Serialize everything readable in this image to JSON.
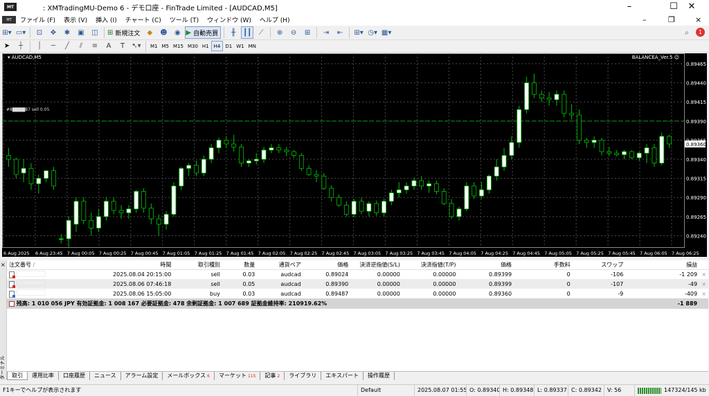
{
  "window": {
    "title": ": XMTradingMU-Demo 6 - デモ口座 - FinTrade Limited - [AUDCAD,M5]",
    "app_icon": "mt4-icon",
    "buttons": [
      "minimize-icon",
      "maximize-icon",
      "close-icon"
    ]
  },
  "menu": {
    "items": [
      "ファイル (F)",
      "表示 (V)",
      "挿入 (I)",
      "チャート (C)",
      "ツール (T)",
      "ウィンドウ (W)",
      "ヘルプ (H)"
    ],
    "search_icon": "search-icon",
    "alert_count": "1"
  },
  "toolbar": {
    "new_order": "新規注文",
    "auto_trade": "自動売買"
  },
  "timeframes": [
    "M1",
    "M5",
    "M15",
    "M30",
    "H1",
    "H4",
    "D1",
    "W1",
    "MN"
  ],
  "timeframe_active": "H4",
  "drawing_tools": {
    "text_tool": "A",
    "label_tool": "T"
  },
  "chart": {
    "symbol_label": "AUDCAD,M5",
    "ea_label": "BALANCEA_Ver.5 ☺",
    "order_line_label": "#8▇▇▇▇87 sell 0.05",
    "current_price": "0.89360",
    "colors": {
      "background": "#000000",
      "bull": "#ffffff",
      "bear": "#000000",
      "wick": "#00c000",
      "grid": "#4a4a4a",
      "order_line": "#00a000"
    }
  },
  "chart_data": {
    "type": "candlestick",
    "price_axis_ticks": [
      "0.89465",
      "0.89440",
      "0.89415",
      "0.89390",
      "0.89365",
      "0.89340",
      "0.89315",
      "0.89290",
      "0.89265",
      "0.89240"
    ],
    "time_axis_ticks": [
      "6 Aug 2025",
      "6 Aug 23:45",
      "7 Aug 00:05",
      "7 Aug 00:25",
      "7 Aug 00:45",
      "7 Aug 01:05",
      "7 Aug 01:25",
      "7 Aug 01:45",
      "7 Aug 02:05",
      "7 Aug 02:25",
      "7 Aug 02:45",
      "7 Aug 03:05",
      "7 Aug 03:25",
      "7 Aug 03:45",
      "7 Aug 04:05",
      "7 Aug 04:25",
      "7 Aug 04:45",
      "7 Aug 05:05",
      "7 Aug 05:25",
      "7 Aug 05:45",
      "7 Aug 06:05",
      "7 Aug 06:25"
    ],
    "order_line_price": 0.8939,
    "current_price": 0.8936,
    "ylim": [
      0.89225,
      0.89475
    ],
    "candles": [
      {
        "o": 0.89345,
        "h": 0.89355,
        "l": 0.8933,
        "c": 0.8934
      },
      {
        "o": 0.8934,
        "h": 0.89342,
        "l": 0.89315,
        "c": 0.8932
      },
      {
        "o": 0.89322,
        "h": 0.8934,
        "l": 0.8931,
        "c": 0.89328
      },
      {
        "o": 0.89328,
        "h": 0.89335,
        "l": 0.893,
        "c": 0.89308
      },
      {
        "o": 0.89308,
        "h": 0.8932,
        "l": 0.89295,
        "c": 0.89315
      },
      {
        "o": 0.89315,
        "h": 0.89326,
        "l": 0.8931,
        "c": 0.89325
      },
      {
        "o": 0.89325,
        "h": 0.8933,
        "l": 0.893,
        "c": 0.89305
      },
      {
        "o": 0.89236,
        "h": 0.89242,
        "l": 0.8923,
        "c": 0.89236
      },
      {
        "o": 0.89236,
        "h": 0.89265,
        "l": 0.89225,
        "c": 0.8926
      },
      {
        "o": 0.89255,
        "h": 0.8929,
        "l": 0.89245,
        "c": 0.89285
      },
      {
        "o": 0.89285,
        "h": 0.8929,
        "l": 0.89255,
        "c": 0.8926
      },
      {
        "o": 0.8926,
        "h": 0.8927,
        "l": 0.8924,
        "c": 0.8925
      },
      {
        "o": 0.8925,
        "h": 0.89275,
        "l": 0.89245,
        "c": 0.89265
      },
      {
        "o": 0.89265,
        "h": 0.8929,
        "l": 0.8926,
        "c": 0.89285
      },
      {
        "o": 0.89285,
        "h": 0.8929,
        "l": 0.89268,
        "c": 0.89273
      },
      {
        "o": 0.89273,
        "h": 0.8928,
        "l": 0.89262,
        "c": 0.8927
      },
      {
        "o": 0.8927,
        "h": 0.8928,
        "l": 0.89262,
        "c": 0.89275
      },
      {
        "o": 0.89275,
        "h": 0.893,
        "l": 0.8927,
        "c": 0.89298
      },
      {
        "o": 0.89298,
        "h": 0.89302,
        "l": 0.8927,
        "c": 0.89276
      },
      {
        "o": 0.89276,
        "h": 0.89282,
        "l": 0.89255,
        "c": 0.89262
      },
      {
        "o": 0.89262,
        "h": 0.89268,
        "l": 0.8924,
        "c": 0.89255
      },
      {
        "o": 0.89255,
        "h": 0.89272,
        "l": 0.89248,
        "c": 0.89268
      },
      {
        "o": 0.89268,
        "h": 0.8931,
        "l": 0.89265,
        "c": 0.89305
      },
      {
        "o": 0.89305,
        "h": 0.8933,
        "l": 0.893,
        "c": 0.89328
      },
      {
        "o": 0.89328,
        "h": 0.89335,
        "l": 0.89318,
        "c": 0.89332
      },
      {
        "o": 0.89332,
        "h": 0.89338,
        "l": 0.89318,
        "c": 0.89322
      },
      {
        "o": 0.89322,
        "h": 0.89345,
        "l": 0.89318,
        "c": 0.8934
      },
      {
        "o": 0.8934,
        "h": 0.8936,
        "l": 0.89335,
        "c": 0.89355
      },
      {
        "o": 0.89355,
        "h": 0.89368,
        "l": 0.89348,
        "c": 0.89365
      },
      {
        "o": 0.89365,
        "h": 0.8937,
        "l": 0.89355,
        "c": 0.8936
      },
      {
        "o": 0.8936,
        "h": 0.89372,
        "l": 0.8935,
        "c": 0.89356
      },
      {
        "o": 0.89356,
        "h": 0.8936,
        "l": 0.8933,
        "c": 0.89335
      },
      {
        "o": 0.89335,
        "h": 0.8934,
        "l": 0.8933,
        "c": 0.89338
      },
      {
        "o": 0.89338,
        "h": 0.89348,
        "l": 0.89333,
        "c": 0.8934
      },
      {
        "o": 0.8934,
        "h": 0.89356,
        "l": 0.89335,
        "c": 0.89352
      },
      {
        "o": 0.89352,
        "h": 0.8936,
        "l": 0.89348,
        "c": 0.89355
      },
      {
        "o": 0.89355,
        "h": 0.8936,
        "l": 0.89348,
        "c": 0.89352
      },
      {
        "o": 0.89352,
        "h": 0.89356,
        "l": 0.89344,
        "c": 0.8935
      },
      {
        "o": 0.8935,
        "h": 0.89352,
        "l": 0.89342,
        "c": 0.89345
      },
      {
        "o": 0.89345,
        "h": 0.89348,
        "l": 0.89325,
        "c": 0.89328
      },
      {
        "o": 0.89328,
        "h": 0.89332,
        "l": 0.89318,
        "c": 0.8932
      },
      {
        "o": 0.8932,
        "h": 0.89326,
        "l": 0.8931,
        "c": 0.89318
      },
      {
        "o": 0.89318,
        "h": 0.89322,
        "l": 0.893,
        "c": 0.89302
      },
      {
        "o": 0.89302,
        "h": 0.89306,
        "l": 0.89285,
        "c": 0.8929
      },
      {
        "o": 0.8929,
        "h": 0.89294,
        "l": 0.89278,
        "c": 0.8928
      },
      {
        "o": 0.8928,
        "h": 0.89285,
        "l": 0.89265,
        "c": 0.89268
      },
      {
        "o": 0.89268,
        "h": 0.89288,
        "l": 0.89264,
        "c": 0.89285
      },
      {
        "o": 0.89285,
        "h": 0.8929,
        "l": 0.89268,
        "c": 0.89272
      },
      {
        "o": 0.89272,
        "h": 0.89285,
        "l": 0.89265,
        "c": 0.89282
      },
      {
        "o": 0.89282,
        "h": 0.89286,
        "l": 0.89266,
        "c": 0.8927
      },
      {
        "o": 0.8927,
        "h": 0.89288,
        "l": 0.89266,
        "c": 0.89285
      },
      {
        "o": 0.89285,
        "h": 0.893,
        "l": 0.8928,
        "c": 0.89296
      },
      {
        "o": 0.89296,
        "h": 0.8931,
        "l": 0.8929,
        "c": 0.893
      },
      {
        "o": 0.893,
        "h": 0.8931,
        "l": 0.89295,
        "c": 0.89305
      },
      {
        "o": 0.89305,
        "h": 0.89316,
        "l": 0.893,
        "c": 0.89312
      },
      {
        "o": 0.89312,
        "h": 0.89318,
        "l": 0.893,
        "c": 0.89305
      },
      {
        "o": 0.89305,
        "h": 0.89312,
        "l": 0.89296,
        "c": 0.89308
      },
      {
        "o": 0.89308,
        "h": 0.89312,
        "l": 0.89294,
        "c": 0.89298
      },
      {
        "o": 0.89298,
        "h": 0.89302,
        "l": 0.8928,
        "c": 0.89282
      },
      {
        "o": 0.89282,
        "h": 0.89288,
        "l": 0.89262,
        "c": 0.89265
      },
      {
        "o": 0.89265,
        "h": 0.89278,
        "l": 0.8926,
        "c": 0.89275
      },
      {
        "o": 0.89275,
        "h": 0.8931,
        "l": 0.89272,
        "c": 0.89305
      },
      {
        "o": 0.89305,
        "h": 0.8931,
        "l": 0.89288,
        "c": 0.89292
      },
      {
        "o": 0.89292,
        "h": 0.8931,
        "l": 0.89288,
        "c": 0.893
      },
      {
        "o": 0.893,
        "h": 0.8932,
        "l": 0.89295,
        "c": 0.89318
      },
      {
        "o": 0.89318,
        "h": 0.8934,
        "l": 0.89312,
        "c": 0.8933
      },
      {
        "o": 0.8933,
        "h": 0.89355,
        "l": 0.89325,
        "c": 0.89345
      },
      {
        "o": 0.89345,
        "h": 0.8937,
        "l": 0.8934,
        "c": 0.89362
      },
      {
        "o": 0.89362,
        "h": 0.8941,
        "l": 0.89355,
        "c": 0.89405
      },
      {
        "o": 0.89405,
        "h": 0.89448,
        "l": 0.894,
        "c": 0.8944
      },
      {
        "o": 0.8944,
        "h": 0.89452,
        "l": 0.8942,
        "c": 0.89425
      },
      {
        "o": 0.89425,
        "h": 0.8943,
        "l": 0.89415,
        "c": 0.8942
      },
      {
        "o": 0.8942,
        "h": 0.89428,
        "l": 0.8941,
        "c": 0.89418
      },
      {
        "o": 0.89418,
        "h": 0.8943,
        "l": 0.8941,
        "c": 0.89425
      },
      {
        "o": 0.89425,
        "h": 0.8943,
        "l": 0.89395,
        "c": 0.894
      },
      {
        "o": 0.894,
        "h": 0.89412,
        "l": 0.89392,
        "c": 0.89398
      },
      {
        "o": 0.89398,
        "h": 0.89405,
        "l": 0.8936,
        "c": 0.89365
      },
      {
        "o": 0.89365,
        "h": 0.89368,
        "l": 0.89355,
        "c": 0.89362
      },
      {
        "o": 0.89362,
        "h": 0.8937,
        "l": 0.89355,
        "c": 0.89365
      },
      {
        "o": 0.89365,
        "h": 0.89368,
        "l": 0.89345,
        "c": 0.8935
      },
      {
        "o": 0.8935,
        "h": 0.89356,
        "l": 0.89344,
        "c": 0.89348
      },
      {
        "o": 0.89348,
        "h": 0.89352,
        "l": 0.89344,
        "c": 0.89346
      },
      {
        "o": 0.89346,
        "h": 0.89352,
        "l": 0.8934,
        "c": 0.8935
      },
      {
        "o": 0.8935,
        "h": 0.89352,
        "l": 0.8934,
        "c": 0.89342
      },
      {
        "o": 0.89342,
        "h": 0.8935,
        "l": 0.89338,
        "c": 0.89348
      },
      {
        "o": 0.89348,
        "h": 0.8936,
        "l": 0.89335,
        "c": 0.89355
      },
      {
        "o": 0.89355,
        "h": 0.8936,
        "l": 0.8933,
        "c": 0.89335
      },
      {
        "o": 0.89335,
        "h": 0.89375,
        "l": 0.89332,
        "c": 0.8937
      },
      {
        "o": 0.8937,
        "h": 0.89372,
        "l": 0.89355,
        "c": 0.8936
      }
    ]
  },
  "orders_table": {
    "columns": [
      "注文番号",
      "時間",
      "取引種別",
      "数量",
      "通貨ペア",
      "価格",
      "決済逆指値(S/L)",
      "決済指値(T/P)",
      "価格",
      "手数料",
      "スワップ",
      "損益"
    ],
    "sort_indicator": "/",
    "rows": [
      {
        "id": "",
        "time": "2025.08.04 20:15:00",
        "type": "sell",
        "lots": "0.03",
        "symbol": "audcad",
        "open_price": "0.89024",
        "sl": "0.00000",
        "tp": "0.00000",
        "price": "0.89399",
        "commission": "0",
        "swap": "-106",
        "profit": "-1 209"
      },
      {
        "id": "",
        "time": "2025.08.06 07:46:18",
        "type": "sell",
        "lots": "0.05",
        "symbol": "audcad",
        "open_price": "0.89390",
        "sl": "0.00000",
        "tp": "0.00000",
        "price": "0.89399",
        "commission": "0",
        "swap": "-107",
        "profit": "-49"
      },
      {
        "id": "",
        "time": "2025.08.06 15:05:00",
        "type": "buy",
        "lots": "0.03",
        "symbol": "audcad",
        "open_price": "0.89487",
        "sl": "0.00000",
        "tp": "0.00000",
        "price": "0.89360",
        "commission": "0",
        "swap": "-9",
        "profit": "-409"
      }
    ],
    "summary_text": "残高: 1 010 056 JPY  有効証拠金: 1 008 167  必要証拠金: 478  余剰証拠金: 1 007 689  証拠金維持率: 210919.62%",
    "summary_profit": "-1 889",
    "close_icon": "×"
  },
  "terminal_label": "ターミナル",
  "tabs": [
    {
      "label": "取引",
      "badge": ""
    },
    {
      "label": "運用比率",
      "badge": ""
    },
    {
      "label": "口座履歴",
      "badge": ""
    },
    {
      "label": "ニュース",
      "badge": ""
    },
    {
      "label": "アラーム設定",
      "badge": ""
    },
    {
      "label": "メールボックス",
      "badge": "6"
    },
    {
      "label": "マーケット",
      "badge": "115"
    },
    {
      "label": "記事",
      "badge": "2"
    },
    {
      "label": "ライブラリ",
      "badge": ""
    },
    {
      "label": "エキスパート",
      "badge": ""
    },
    {
      "label": "操作履歴",
      "badge": ""
    }
  ],
  "statusbar": {
    "help": "F1キーでヘルプが表示されます",
    "profile": "Default",
    "datetime": "2025.08.07 01:55",
    "open": "O: 0.89340",
    "high": "H: 0.89348",
    "low": "L: 0.89337",
    "close": "C: 0.89342",
    "volume": "V: 56",
    "traffic": "147324/145 kb"
  }
}
